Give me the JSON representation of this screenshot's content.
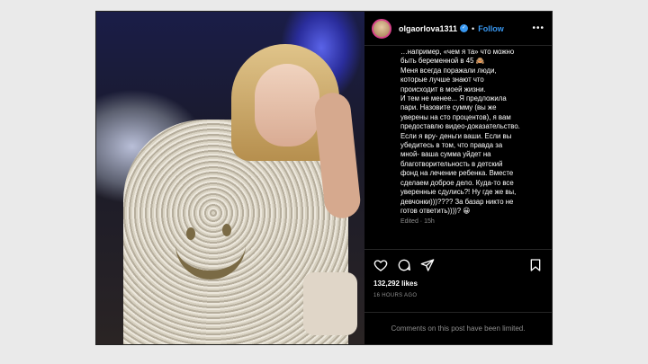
{
  "header": {
    "username": "olgaorlova1311",
    "separator": "•",
    "follow_label": "Follow",
    "more_label": "•••"
  },
  "caption": {
    "text": "…например, «чем я та» что можно\nбыть беременной в 45 🙈\nМеня всегда поражали люди,\nкоторые лучше знают что\nпроисходит в моей жизни.\nИ тем не менее... Я предложила\nпари. Назовите сумму (вы же\nуверены на сто процентов), я вам\nпредоставлю видео-доказательство.\nЕсли я вру- деньги ваши. Если вы\nубедитесь в том, что правда за\nмной- ваша сумма уйдет на\nблаготворительность в детский\nфонд на лечение ребенка. Вместе\nсделаем доброе дело. Куда-то все\nуверенные сдулись?! Ну где же вы,\nдевчонки)))???? За базар никто не\nготов ответить))))? 😀",
    "edited": "Edited · 15h"
  },
  "actions": {
    "like_icon": "heart-icon",
    "comment_icon": "comment-icon",
    "share_icon": "share-icon",
    "save_icon": "bookmark-icon"
  },
  "likes": "132,292 likes",
  "time_ago": "16 HOURS AGO",
  "comments_limited": "Comments on this post have been limited.",
  "colors": {
    "accent": "#3897f0",
    "background": "#000000",
    "muted": "#8e8e8e"
  }
}
